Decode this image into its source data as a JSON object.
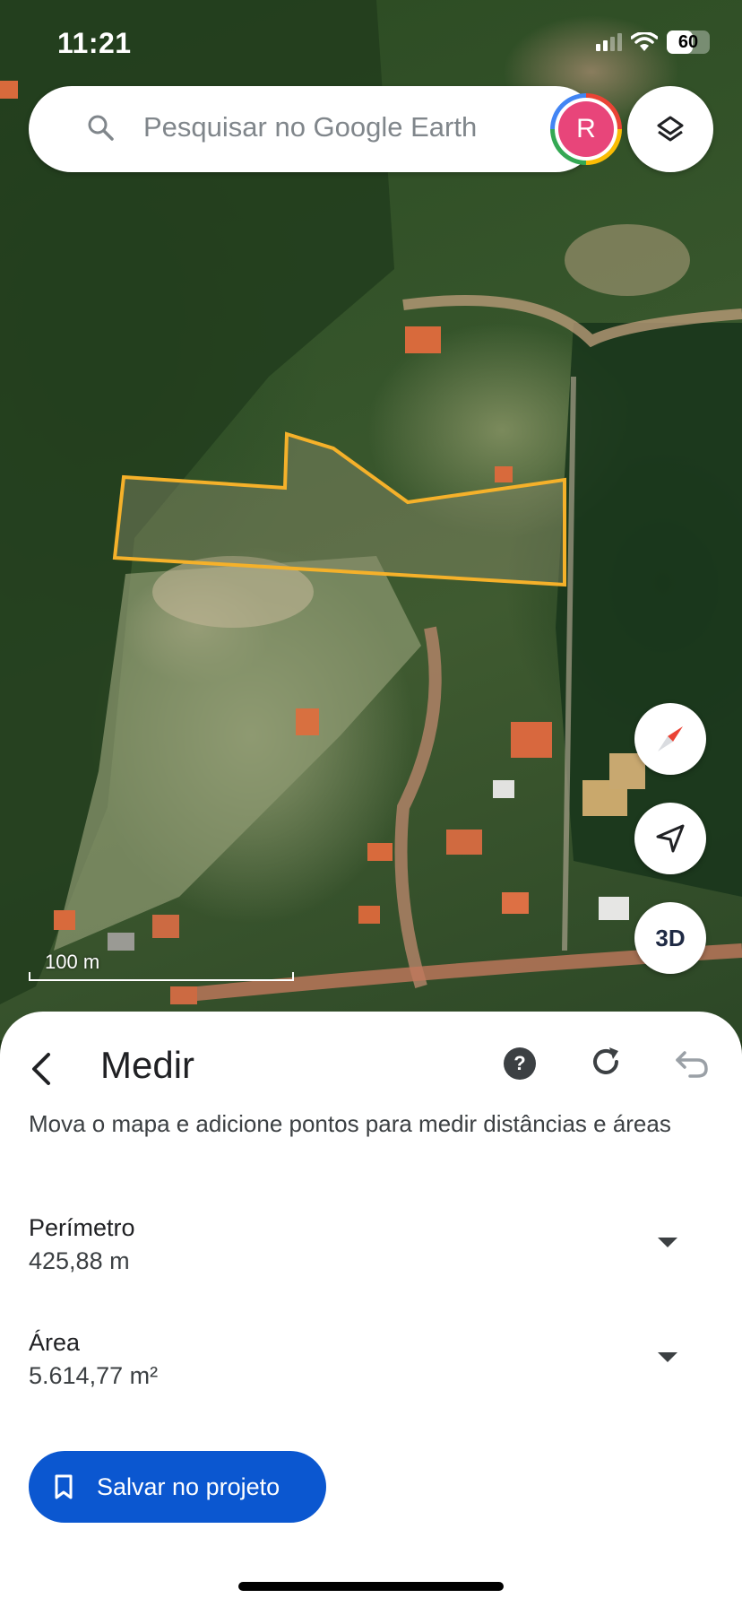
{
  "status_bar": {
    "time": "11:21",
    "battery": "60",
    "battery_level": 0.6
  },
  "search": {
    "placeholder": "Pesquisar no Google Earth",
    "avatar_letter": "R",
    "avatar_color": "#e8457a"
  },
  "map": {
    "scale_label": "100 m",
    "measure_outline_color": "#f5b12a",
    "fab_3d_label": "3D"
  },
  "sheet": {
    "title": "Medir",
    "instructions": "Mova o mapa e adicione pontos para medir distâncias e áreas",
    "metrics": [
      {
        "label": "Perímetro",
        "value": "425,88 m"
      },
      {
        "label": "Área",
        "value": "5.614,77 m²"
      }
    ],
    "save_label": "Salvar no projeto",
    "accent_color": "#0b57d0"
  }
}
